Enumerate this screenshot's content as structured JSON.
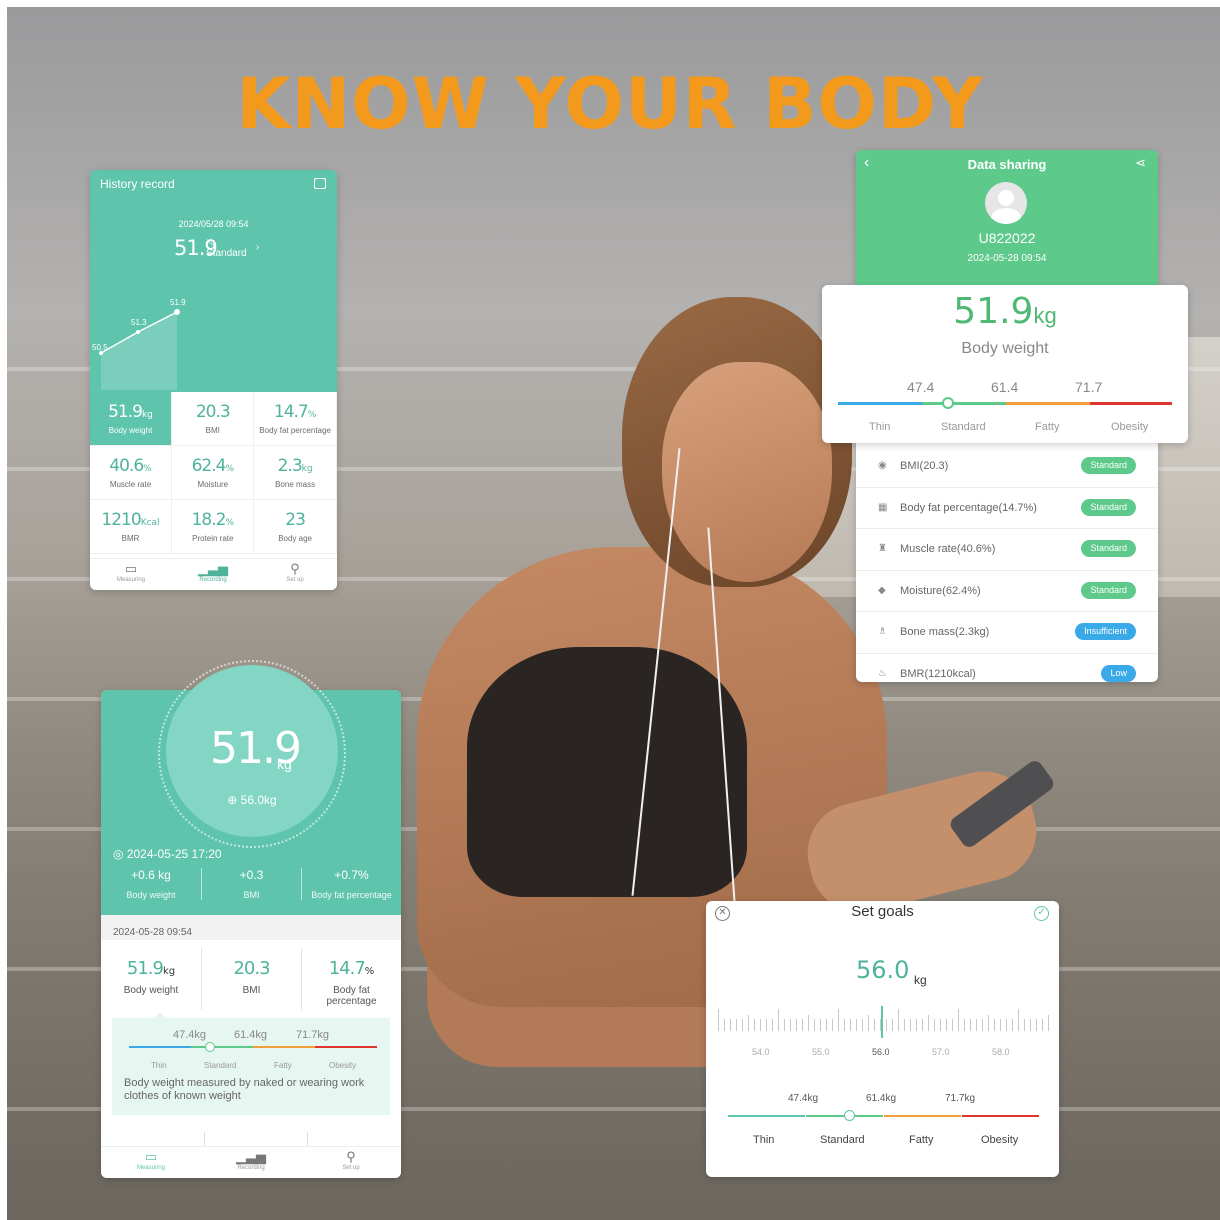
{
  "headline": "KNOW YOUR BODY",
  "history": {
    "title": "History record",
    "date": "2024/05/28 09:54",
    "weight": "51.9",
    "weight_unit": "kg",
    "status": "Standard",
    "chart_points": [
      "50.5",
      "51.3",
      "51.9"
    ],
    "metrics": [
      {
        "value": "51.9",
        "unit": "kg",
        "label": "Body weight"
      },
      {
        "value": "20.3",
        "unit": "",
        "label": "BMI"
      },
      {
        "value": "14.7",
        "unit": "%",
        "label": "Body fat percentage"
      },
      {
        "value": "40.6",
        "unit": "%",
        "label": "Muscle rate"
      },
      {
        "value": "62.4",
        "unit": "%",
        "label": "Moisture"
      },
      {
        "value": "2.3",
        "unit": "kg",
        "label": "Bone mass"
      },
      {
        "value": "1210",
        "unit": "Kcal",
        "label": "BMR"
      },
      {
        "value": "18.2",
        "unit": "%",
        "label": "Protein rate"
      },
      {
        "value": "23",
        "unit": "",
        "label": "Body age"
      }
    ],
    "nav": [
      "Measuring",
      "Recording",
      "Set up"
    ]
  },
  "share": {
    "title": "Data sharing",
    "user": "U822022",
    "date": "2024-05-28 09:54",
    "weight": "51.9",
    "weight_unit": "kg",
    "weight_label": "Body weight",
    "thresholds": [
      "47.4",
      "61.4",
      "71.7"
    ],
    "ranges": [
      "Thin",
      "Standard",
      "Fatty",
      "Obesity"
    ],
    "rows": [
      {
        "label": "BMI(20.3)",
        "badge": "Standard",
        "color": "#5dc98a"
      },
      {
        "label": "Body fat percentage(14.7%)",
        "badge": "Standard",
        "color": "#5dc98a"
      },
      {
        "label": "Muscle rate(40.6%)",
        "badge": "Standard",
        "color": "#5dc98a"
      },
      {
        "label": "Moisture(62.4%)",
        "badge": "Standard",
        "color": "#5dc98a"
      },
      {
        "label": "Bone mass(2.3kg)",
        "badge": "Insufficient",
        "color": "#3aa9e8"
      },
      {
        "label": "BMR(1210kcal)",
        "badge": "Low",
        "color": "#3aa9e8"
      }
    ]
  },
  "main": {
    "weight": "51.9",
    "unit": "kg",
    "goal": "56.0kg",
    "date": "2024-05-25 17:20",
    "changes": [
      {
        "value": "+0.6 kg",
        "label": "Body weight"
      },
      {
        "value": "+0.3",
        "label": "BMI"
      },
      {
        "value": "+0.7%",
        "label": "Body fat percentage"
      }
    ],
    "record_date": "2024-05-28 09:54",
    "metrics": [
      {
        "value": "51.9",
        "unit": "kg",
        "label": "Body weight"
      },
      {
        "value": "20.3",
        "unit": "",
        "label": "BMI"
      },
      {
        "value": "14.7",
        "unit": "%",
        "label": "Body fat percentage"
      }
    ],
    "thresholds": [
      "47.4kg",
      "61.4kg",
      "71.7kg"
    ],
    "ranges": [
      "Thin",
      "Standard",
      "Fatty",
      "Obesity"
    ],
    "note": "Body weight measured by naked or wearing work clothes of known weight",
    "nav": [
      "Measuring",
      "Recording",
      "Set up"
    ]
  },
  "goals": {
    "title": "Set goals",
    "value": "56.0",
    "unit": "kg",
    "ticks": [
      "54.0",
      "55.0",
      "56.0",
      "57.0",
      "58.0"
    ],
    "thresholds": [
      "47.4kg",
      "61.4kg",
      "71.7kg"
    ],
    "ranges": [
      "Thin",
      "Standard",
      "Fatty",
      "Obesity"
    ]
  },
  "colors": {
    "teal": "#5ec4ac",
    "green": "#5dc98a",
    "orange": "#f39a1c",
    "thin": "#3aa9e8",
    "standard": "#5dc98a",
    "fatty": "#f0a03a",
    "obesity": "#e0352f"
  }
}
